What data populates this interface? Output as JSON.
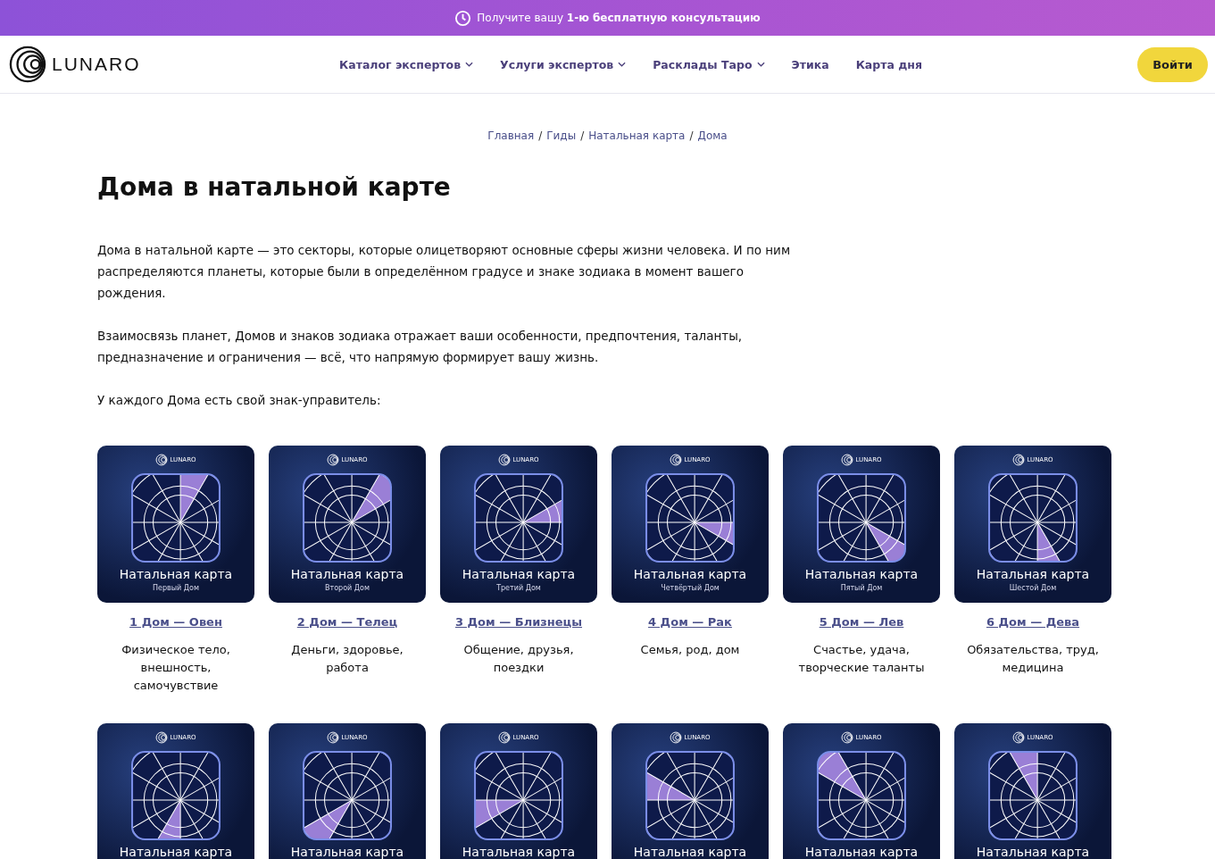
{
  "promo_banner": {
    "text": "Получите вашу **1-ю бесплатную консультацию**"
  },
  "header": {
    "logo": "LUNARO",
    "nav": [
      {
        "label": "Каталог экспертов",
        "dropdown": true
      },
      {
        "label": "Услуги экспертов",
        "dropdown": true
      },
      {
        "label": "Расклады Таро",
        "dropdown": true
      },
      {
        "label": "Этика",
        "dropdown": false
      },
      {
        "label": "Карта дня",
        "dropdown": false
      }
    ],
    "login_button": "Войти"
  },
  "breadcrumbs": [
    {
      "label": "Главная"
    },
    {
      "separator": "/",
      "label": "Гиды"
    },
    {
      "separator": "/",
      "label": "Натальная карта"
    },
    {
      "separator": "/",
      "label": "Дома"
    }
  ],
  "title": "Дома в натальной карте",
  "paragraphs": [
    "Дома в натальной карте — это секторы, которые олицетворяют основные сферы жизни человека. И по ним распределяются планеты, которые были в определённом градусе и знаке зодиака в момент вашего рождения.",
    "Взаимосвязь планет, Домов и знаков зодиака отражает ваши особенности, предпочтения, таланты, предназначение и ограничения — всё, что напрямую формирует вашу жизнь.",
    "У каждого Дома есть свой знак-управитель:"
  ],
  "houses": [
    {
      "brand": "LUNARO",
      "image_title": "Натальная карта",
      "image_subtitle": "Первый Дом",
      "link": "1 Дом — Овен",
      "description": "Физическое тело, внешность, самочувствие"
    },
    {
      "brand": "LUNARO",
      "image_title": "Натальная карта",
      "image_subtitle": "Второй Дом",
      "link": "2 Дом — Телец",
      "description": "Деньги, здоровье, работа"
    },
    {
      "brand": "LUNARO",
      "image_title": "Натальная карта",
      "image_subtitle": "Третий Дом",
      "link": "3 Дом — Близнецы",
      "description": "Общение, друзья, поездки"
    },
    {
      "brand": "LUNARO",
      "image_title": "Натальная карта",
      "image_subtitle": "Четвёртый Дом",
      "link": "4 Дом — Рак",
      "description": "Семья, род, дом"
    },
    {
      "brand": "LUNARO",
      "image_title": "Натальная карта",
      "image_subtitle": "Пятый Дом",
      "link": "5 Дом — Лев",
      "description": "Счастье, удача, творческие таланты"
    },
    {
      "brand": "LUNARO",
      "image_title": "Натальная карта",
      "image_subtitle": "Шестой Дом",
      "link": "6 Дом — Дева",
      "description": "Обязательства, труд, медицина"
    },
    {
      "brand": "LUNARO",
      "image_title": "Натальная карта"
    },
    {
      "brand": "LUNARO",
      "image_title": "Натальная карта"
    },
    {
      "brand": "LUNARO",
      "image_title": "Натальная карта"
    },
    {
      "brand": "LUNARO",
      "image_title": "Натальная карта"
    },
    {
      "brand": "LUNARO",
      "image_title": "Натальная карта"
    },
    {
      "brand": "LUNARO",
      "image_title": "Натальная карта"
    }
  ]
}
